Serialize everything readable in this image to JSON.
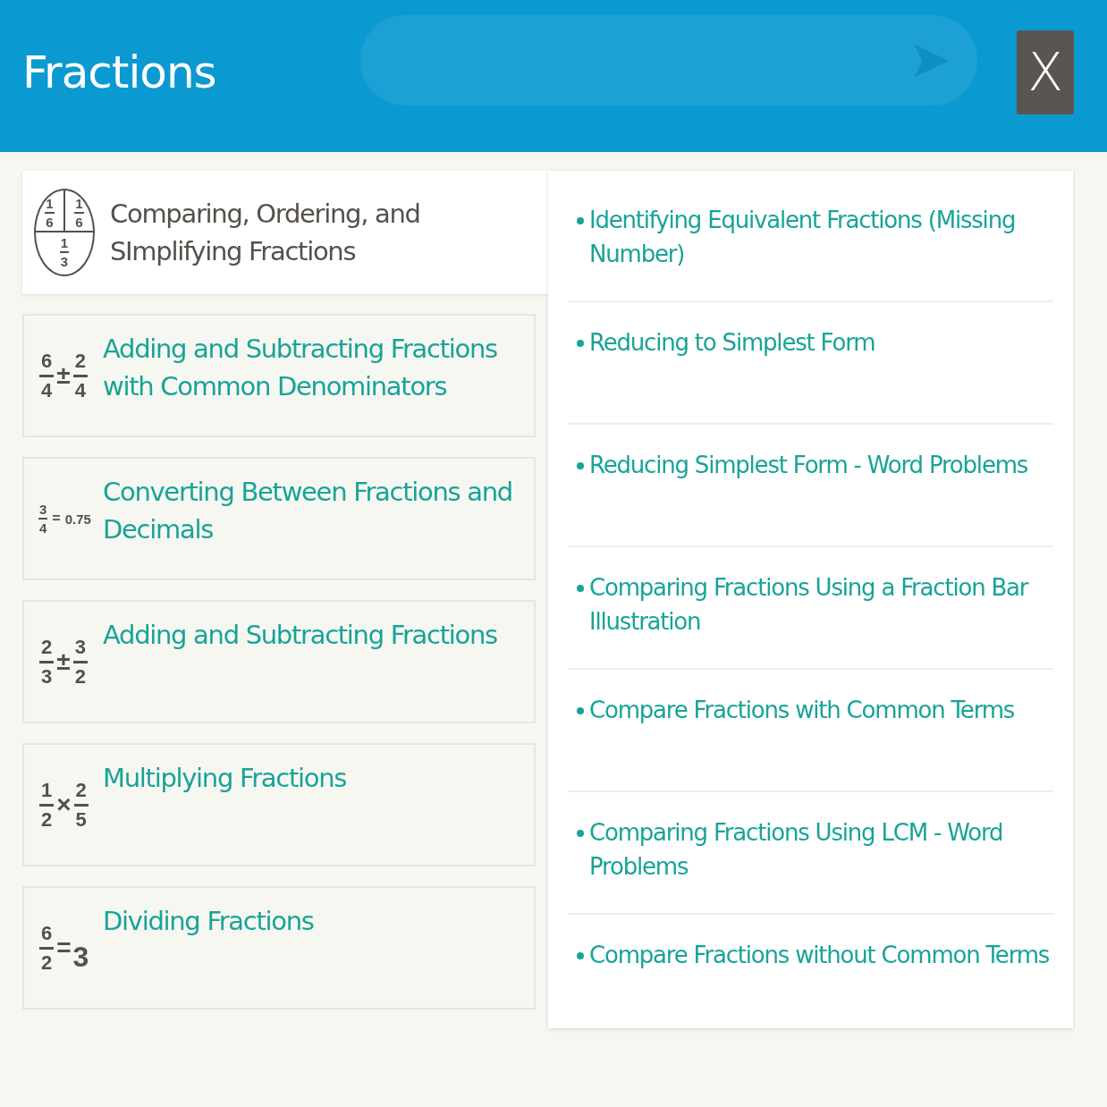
{
  "dialog": {
    "title": "Fractions",
    "close_label": "X"
  },
  "topics": [
    {
      "label": "Comparing, Ordering, and SImplifying Fractions",
      "selected": true,
      "icon": {
        "kind": "circle",
        "top": [
          {
            "n": "1",
            "d": "6"
          },
          {
            "n": "1",
            "d": "6"
          }
        ],
        "bottom": {
          "n": "1",
          "d": "3"
        }
      }
    },
    {
      "label": "Adding and Subtracting Fractions with Common Denominators",
      "selected": false,
      "icon": {
        "kind": "equation",
        "parts": [
          {
            "n": "6",
            "d": "4"
          },
          {
            "op": "±"
          },
          {
            "n": "2",
            "d": "4"
          }
        ]
      }
    },
    {
      "label": "Converting Between Fractions and Decimals",
      "selected": false,
      "icon": {
        "kind": "decimal_equation",
        "parts": [
          {
            "n": "3",
            "d": "4"
          },
          {
            "op": "="
          },
          {
            "t": "0.75"
          }
        ]
      }
    },
    {
      "label": "Adding and Subtracting Fractions",
      "selected": false,
      "icon": {
        "kind": "equation",
        "parts": [
          {
            "n": "2",
            "d": "3"
          },
          {
            "op": "±"
          },
          {
            "n": "3",
            "d": "2"
          }
        ]
      }
    },
    {
      "label": "Multiplying Fractions",
      "selected": false,
      "icon": {
        "kind": "equation",
        "parts": [
          {
            "n": "1",
            "d": "2"
          },
          {
            "op": "×"
          },
          {
            "n": "2",
            "d": "5"
          }
        ]
      }
    },
    {
      "label": "Dividing Fractions",
      "selected": false,
      "icon": {
        "kind": "equation",
        "parts": [
          {
            "n": "6",
            "d": "2"
          },
          {
            "op": "="
          },
          {
            "t": "3"
          }
        ]
      }
    }
  ],
  "subtopics": [
    "Identifying Equivalent Fractions (Missing Number)",
    "Reducing to Simplest Form",
    "Reducing Simplest Form - Word Problems",
    "Comparing Fractions Using a Fraction Bar Illustration",
    "Compare Fractions with Common Terms",
    "Comparing Fractions Using LCM - Word Problems",
    "Compare Fractions without Common Terms"
  ]
}
